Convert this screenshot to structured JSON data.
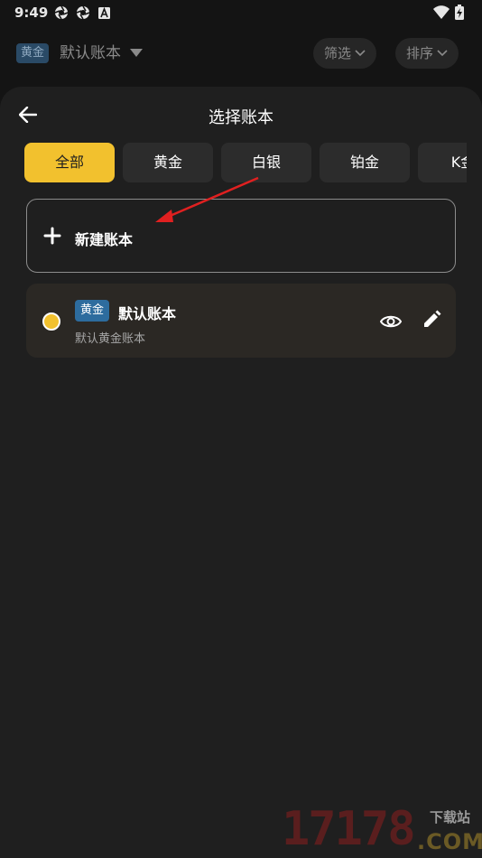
{
  "status_bar": {
    "time": "9:49",
    "icons": [
      "aperture-icon",
      "aperture-icon",
      "font-a-icon",
      "wifi-icon",
      "battery-charging-icon"
    ]
  },
  "background_header": {
    "badge": "黄金",
    "title": "默认账本",
    "filter_label": "筛选",
    "sort_label": "排序"
  },
  "sheet": {
    "title": "选择账本",
    "tabs": [
      {
        "label": "全部",
        "active": true
      },
      {
        "label": "黄金",
        "active": false
      },
      {
        "label": "白银",
        "active": false
      },
      {
        "label": "铂金",
        "active": false
      },
      {
        "label": "K金",
        "active": false
      }
    ],
    "new_book_label": "新建账本",
    "books": [
      {
        "badge": "黄金",
        "title": "默认账本",
        "subtitle": "默认黄金账本",
        "dot_color": "#f2c12e"
      }
    ]
  },
  "watermark": {
    "number": "17178",
    "site": "下载站",
    "domain": ".COM"
  },
  "colors": {
    "accent": "#f2c12e",
    "badge_blue": "#2d6c9e",
    "annotation_arrow": "#e02020"
  }
}
